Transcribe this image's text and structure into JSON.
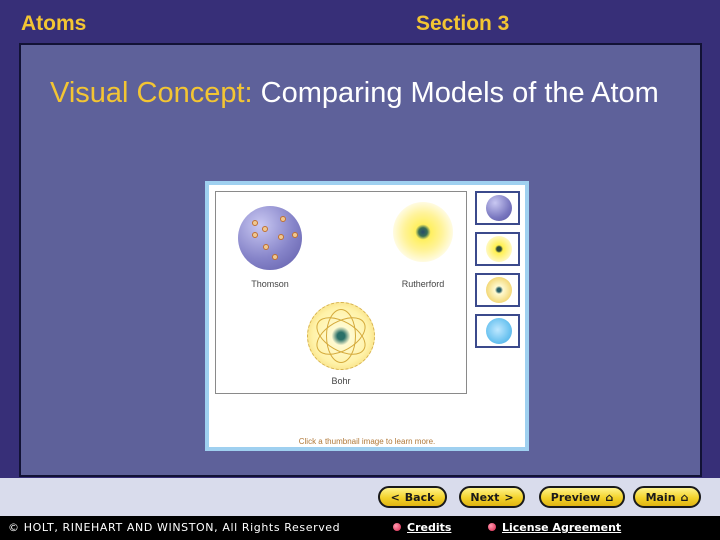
{
  "header": {
    "chapter": "Atoms",
    "section": "Section 3"
  },
  "slide": {
    "title_prefix": "Visual Concept:",
    "title_text": "Comparing Models of the Atom"
  },
  "viewer": {
    "models": [
      {
        "name": "Thomson",
        "icon": "thomson-atom-icon"
      },
      {
        "name": "Rutherford",
        "icon": "rutherford-atom-icon"
      },
      {
        "name": "Bohr",
        "icon": "bohr-atom-icon"
      }
    ],
    "thumbnails": [
      {
        "icon": "thomson-thumb-icon"
      },
      {
        "icon": "rutherford-thumb-icon"
      },
      {
        "icon": "bohr-thumb-icon"
      },
      {
        "icon": "electron-cloud-thumb-icon"
      }
    ],
    "hint": "Click a thumbnail image to learn more."
  },
  "nav": {
    "back": "Back",
    "next": "Next",
    "preview": "Preview",
    "main": "Main"
  },
  "footer": {
    "copyright": "© HOLT, RINEHART AND WINSTON, All Rights Reserved",
    "credits": "Credits",
    "license": "License Agreement"
  },
  "colors": {
    "accent": "#f3c533",
    "background": "#372f78",
    "panel": "#5e619a"
  }
}
